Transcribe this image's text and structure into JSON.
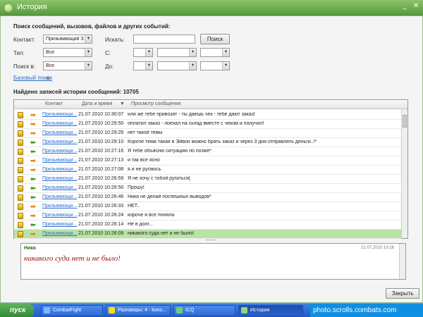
{
  "window": {
    "title": "История"
  },
  "search": {
    "section_title": "Поиск сообщений, вызовов, файлов и других событий:",
    "contact_label": "Контакт:",
    "contact_value": "Призывающий Зл",
    "search_label": "Искать:",
    "search_value": "",
    "search_button": "Поиск",
    "type_label": "Тип:",
    "type_value": "Все",
    "from_label": "С:",
    "searchin_label": "Поиск в:",
    "searchin_value": "Все",
    "to_label": "До:",
    "basic_search_link": "Базовый поиск",
    "basic_search_suffix": "a"
  },
  "results": {
    "found_text": "Найдено записей истории сообщений: 10705"
  },
  "grid": {
    "headers": {
      "contact": "Контакт",
      "datetime": "Дата и время",
      "preview": "Просмотр сообщения"
    },
    "rows": [
      {
        "contact": "Призывающи...",
        "datetime": "21.07.2010 10:30:07",
        "message": "или же тебе привозят - ты даешь чек - тебе дают заказ!",
        "dir": "out"
      },
      {
        "contact": "Призывающи...",
        "datetime": "21.07.2010 10:29:50",
        "message": "оплатил заказ - поехал на склад вместе с чеком и получил!",
        "dir": "out"
      },
      {
        "contact": "Призывающи...",
        "datetime": "21.07.2010 10:29:26",
        "message": "нет такой темы",
        "dir": "out"
      },
      {
        "contact": "Призывающи...",
        "datetime": "21.07.2010 10:29:10",
        "message": "Короче тема такая в Эйвон можно брать заказ и через 3 дня отправлять деньги..!*",
        "dir": "in"
      },
      {
        "contact": "Призывающи...",
        "datetime": "21.07.2010 10:27:16",
        "message": "Я тебе объясню ситуацию по позже*",
        "dir": "in"
      },
      {
        "contact": "Призывающи...",
        "datetime": "21.07.2010 10:27:13",
        "message": "и так все ясно",
        "dir": "out"
      },
      {
        "contact": "Призывающи...",
        "datetime": "21.07.2010 10:27:08",
        "message": "я и не ругаюсь",
        "dir": "out"
      },
      {
        "contact": "Призывающи...",
        "datetime": "21.07.2010 10:26:59",
        "message": "Я не хочу с тобой ругаться(",
        "dir": "in"
      },
      {
        "contact": "Призывающи...",
        "datetime": "21.07.2010 10:26:50",
        "message": "Прошу!",
        "dir": "in"
      },
      {
        "contact": "Призывающи...",
        "datetime": "21.07.2010 10:26:46",
        "message": "Ника не делай поспешных выводов*",
        "dir": "in"
      },
      {
        "contact": "Призывающи...",
        "datetime": "21.07.2010 10:26:33",
        "message": "НЕТ..",
        "dir": "out"
      },
      {
        "contact": "Призывающи...",
        "datetime": "21.07.2010 10:26:24",
        "message": "короче я все поняла",
        "dir": "out"
      },
      {
        "contact": "Призывающи...",
        "datetime": "21.07.2010 10:26:14",
        "message": "Не в долг...",
        "dir": "in"
      },
      {
        "contact": "Призывающи...",
        "datetime": "21.07.2010 10:26:09",
        "message": "никакого суда нет и не было!",
        "dir": "out",
        "selected": true
      }
    ]
  },
  "preview": {
    "name": "Ника",
    "date": "21.07.2010 10:26",
    "text": "никакого суда нет и не было!"
  },
  "footer": {
    "close_button": "Закрыть"
  },
  "taskbar": {
    "start": "пуск",
    "tasks": [
      "CombatFight",
      "Разговоры: 4 - kons...",
      "ICQ",
      "История"
    ],
    "tray": "photo.scrolls.combats.com"
  },
  "colors": {
    "title_bar": "#6aad4b",
    "selected_row": "#b9e3a5",
    "link": "#2a6ecf",
    "preview_text": "#a01010",
    "incoming_arrow": "#3a9a2a",
    "outgoing_arrow": "#e0861a"
  }
}
